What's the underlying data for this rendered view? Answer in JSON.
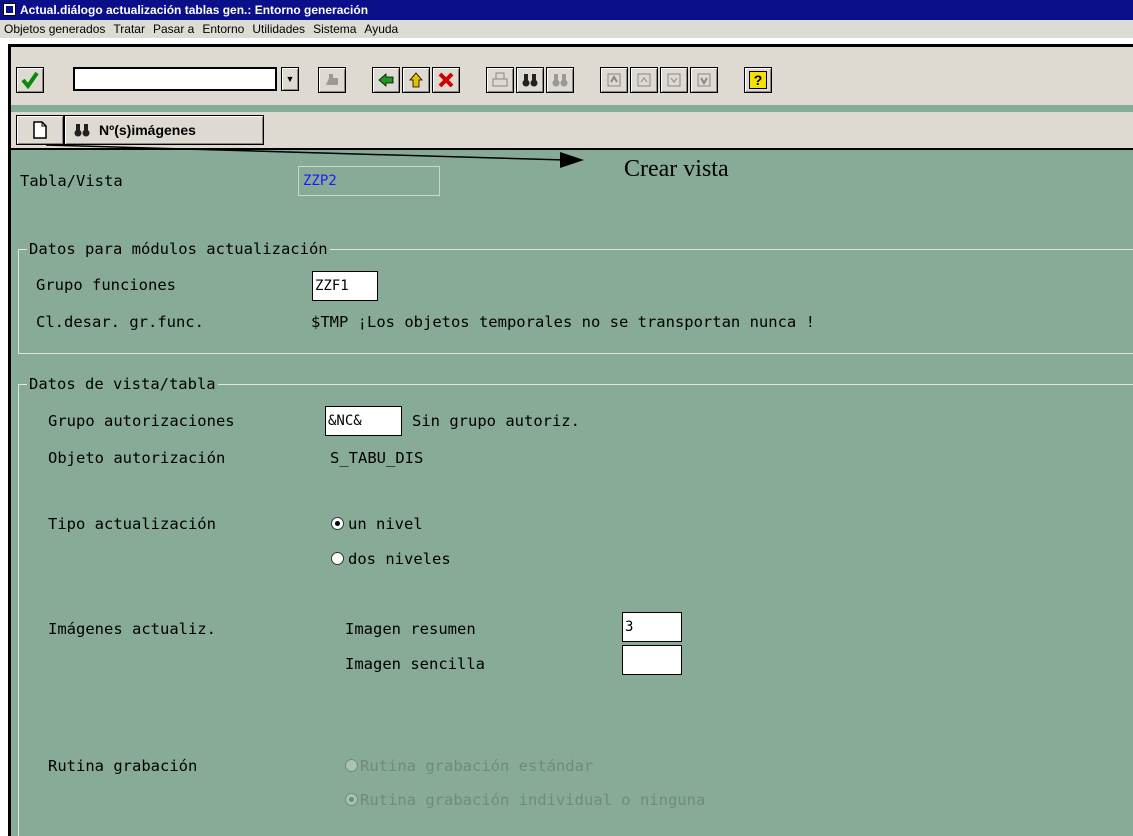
{
  "window": {
    "title": "Actual.diálogo actualización tablas gen.: Entorno generación"
  },
  "menu": [
    "Objetos generados",
    "Tratar",
    "Pasar a",
    "Entorno",
    "Utilidades",
    "Sistema",
    "Ayuda"
  ],
  "toolbar": {
    "nimagenes_label": "Nº(s)imágenes",
    "help_label": "?"
  },
  "annotation": {
    "text": "Crear vista"
  },
  "table": {
    "label": "Tabla/Vista",
    "value": "ZZP2"
  },
  "modules": {
    "group_title": "Datos para módulos actualización",
    "func_group_label": "Grupo funciones",
    "func_group_value": "ZZF1",
    "devclass_label": "Cl.desar. gr.func.",
    "devclass_value": "$TMP ¡Los objetos temporales no se transportan nunca !"
  },
  "view": {
    "group_title": "Datos de vista/tabla",
    "auth_group_label": "Grupo autorizaciones",
    "auth_group_value": "&NC&",
    "auth_group_text": "Sin grupo autoriz.",
    "auth_object_label": "Objeto autorización",
    "auth_object_value": "S_TABU_DIS",
    "type_label": "Tipo actualización",
    "type_options": [
      "un nivel",
      "dos niveles"
    ],
    "type_selected": "un nivel",
    "screens_label": "Imágenes actualiz.",
    "screen_overview_label": "Imagen resumen",
    "screen_overview_value": "3",
    "screen_single_label": "Imagen sencilla",
    "screen_single_value": "",
    "routine_label": "Rutina grabación",
    "routine_options": [
      "Rutina grabación estándar",
      "Rutina grabación individual o ninguna"
    ],
    "routine_selected": "Rutina grabación individual o ninguna"
  },
  "colors": {
    "background": "#88ab98",
    "titlebar": "#0b0f8a",
    "field_value_blue": "#1a1aff"
  }
}
